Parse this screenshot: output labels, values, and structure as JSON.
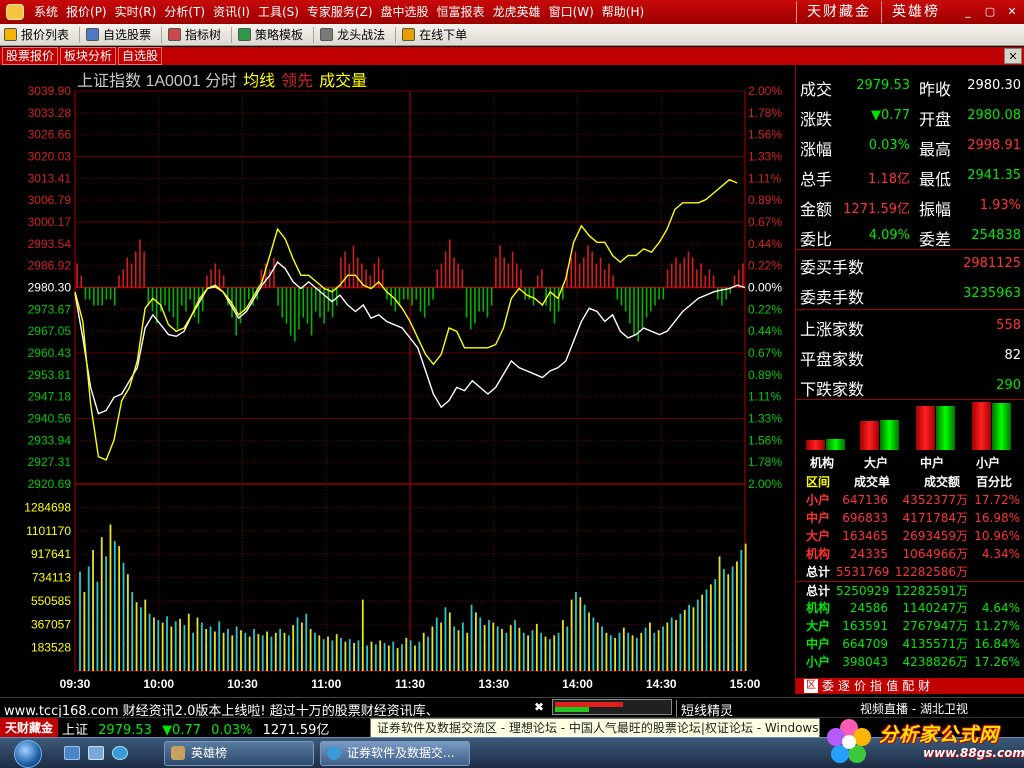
{
  "menubar": {
    "items": [
      "系统",
      "报价(P)",
      "实时(R)",
      "分析(T)",
      "资讯(I)",
      "工具(S)",
      "专家服务(Z)",
      "盘中选股",
      "恒富报表",
      "龙虎英雄",
      "窗口(W)",
      "帮助(H)"
    ],
    "brand": [
      "天财藏金",
      "英雄榜"
    ],
    "window_buttons": [
      "_",
      "▢",
      "✕"
    ]
  },
  "toolbar": {
    "items": [
      "报价列表",
      "自选股票",
      "指标树",
      "策略模板",
      "龙头战法",
      "在线下单"
    ]
  },
  "subtabs": {
    "items": [
      "股票报价",
      "板块分析",
      "自选股"
    ],
    "close": "✕"
  },
  "chart_data": {
    "type": "line",
    "title": "上证指数 1A0001 分时",
    "legend": [
      {
        "name": "均线",
        "color": "#ffff00"
      },
      {
        "name": "领先",
        "color": "#d22020"
      },
      {
        "name": "成交量",
        "color": "#ffff00"
      }
    ],
    "prev_close": 2980.3,
    "price_axis": [
      "3039.90",
      "3033.28",
      "3026.66",
      "3020.03",
      "3013.41",
      "3006.79",
      "3000.17",
      "2993.54",
      "2986.92",
      "2980.30",
      "2973.67",
      "2967.05",
      "2960.43",
      "2953.81",
      "2947.18",
      "2940.56",
      "2933.94",
      "2927.31",
      "2920.69"
    ],
    "pct_axis": [
      "2.00%",
      "1.78%",
      "1.56%",
      "1.33%",
      "1.11%",
      "0.89%",
      "0.67%",
      "0.44%",
      "0.22%",
      "0.00%",
      "0.22%",
      "0.44%",
      "0.67%",
      "0.89%",
      "1.11%",
      "1.33%",
      "1.56%",
      "1.78%",
      "2.00%"
    ],
    "volume_axis": [
      "1284698",
      "1101170",
      "917641",
      "734113",
      "550585",
      "367057",
      "183528"
    ],
    "time_axis": [
      "09:30",
      "10:00",
      "10:30",
      "11:00",
      "11:30",
      "13:30",
      "14:00",
      "14:30",
      "15:00"
    ],
    "ylim": [
      2920.69,
      3039.9
    ],
    "volume_max": 1468226,
    "series": [
      {
        "name": "分时",
        "color": "#ffffff",
        "points": [
          [
            0,
            2978.5
          ],
          [
            2,
            2965
          ],
          [
            4,
            2950
          ],
          [
            6,
            2942
          ],
          [
            8,
            2943
          ],
          [
            10,
            2947
          ],
          [
            12,
            2948
          ],
          [
            14,
            2952
          ],
          [
            16,
            2956
          ],
          [
            18,
            2968
          ],
          [
            20,
            2972
          ],
          [
            22,
            2969
          ],
          [
            24,
            2966
          ],
          [
            26,
            2965.5
          ],
          [
            28,
            2967
          ],
          [
            30,
            2972
          ],
          [
            32,
            2976
          ],
          [
            34,
            2980
          ],
          [
            36,
            2980.5
          ],
          [
            38,
            2979
          ],
          [
            40,
            2975
          ],
          [
            42,
            2971
          ],
          [
            44,
            2973
          ],
          [
            46,
            2977
          ],
          [
            48,
            2981
          ],
          [
            50,
            2984
          ],
          [
            52,
            2988
          ],
          [
            54,
            2986
          ],
          [
            56,
            2982
          ],
          [
            58,
            2980
          ],
          [
            60,
            2982
          ],
          [
            62,
            2980
          ],
          [
            64,
            2978
          ],
          [
            66,
            2976
          ],
          [
            68,
            2978
          ],
          [
            70,
            2975
          ],
          [
            72,
            2973
          ],
          [
            74,
            2975
          ],
          [
            76,
            2971
          ],
          [
            78,
            2972
          ],
          [
            80,
            2970
          ],
          [
            82,
            2969
          ],
          [
            84,
            2968
          ],
          [
            86,
            2965
          ],
          [
            88,
            2962
          ],
          [
            90,
            2955
          ],
          [
            92,
            2948
          ],
          [
            94,
            2944
          ],
          [
            96,
            2946
          ],
          [
            98,
            2950
          ],
          [
            100,
            2949
          ],
          [
            102,
            2952
          ],
          [
            104,
            2950
          ],
          [
            106,
            2948
          ],
          [
            108,
            2950
          ],
          [
            110,
            2954
          ],
          [
            112,
            2958
          ],
          [
            114,
            2956
          ],
          [
            116,
            2955
          ],
          [
            118,
            2954
          ],
          [
            120,
            2953
          ],
          [
            122,
            2955
          ],
          [
            124,
            2956
          ],
          [
            126,
            2958
          ],
          [
            128,
            2964
          ],
          [
            130,
            2970
          ],
          [
            132,
            2974
          ],
          [
            134,
            2973
          ],
          [
            136,
            2970
          ],
          [
            138,
            2972
          ],
          [
            140,
            2967
          ],
          [
            142,
            2965
          ],
          [
            144,
            2966
          ],
          [
            146,
            2968
          ],
          [
            148,
            2967
          ],
          [
            150,
            2966
          ],
          [
            152,
            2967
          ],
          [
            154,
            2970
          ],
          [
            156,
            2973
          ],
          [
            158,
            2975
          ],
          [
            160,
            2977
          ],
          [
            162,
            2978
          ],
          [
            164,
            2979
          ],
          [
            166,
            2979.5
          ],
          [
            168,
            2980
          ],
          [
            170,
            2981
          ],
          [
            172,
            2980.3
          ]
        ]
      },
      {
        "name": "均线",
        "color": "#ffff00",
        "points": [
          [
            0,
            2979
          ],
          [
            2,
            2970
          ],
          [
            4,
            2945
          ],
          [
            6,
            2929
          ],
          [
            8,
            2928
          ],
          [
            10,
            2934
          ],
          [
            12,
            2946
          ],
          [
            14,
            2950
          ],
          [
            16,
            2958
          ],
          [
            18,
            2974
          ],
          [
            20,
            2977
          ],
          [
            22,
            2975
          ],
          [
            24,
            2969
          ],
          [
            26,
            2967
          ],
          [
            28,
            2968
          ],
          [
            30,
            2972
          ],
          [
            32,
            2977
          ],
          [
            34,
            2980
          ],
          [
            36,
            2981
          ],
          [
            38,
            2979
          ],
          [
            40,
            2976
          ],
          [
            42,
            2972
          ],
          [
            44,
            2974
          ],
          [
            46,
            2978
          ],
          [
            48,
            2982
          ],
          [
            50,
            2990
          ],
          [
            52,
            2998
          ],
          [
            54,
            2995
          ],
          [
            56,
            2989
          ],
          [
            58,
            2984
          ],
          [
            60,
            2984
          ],
          [
            62,
            2982
          ],
          [
            64,
            2980
          ],
          [
            66,
            2979
          ],
          [
            68,
            2981
          ],
          [
            70,
            2984
          ],
          [
            72,
            2984
          ],
          [
            74,
            2981
          ],
          [
            76,
            2980
          ],
          [
            78,
            2982
          ],
          [
            80,
            2979
          ],
          [
            82,
            2977
          ],
          [
            84,
            2974
          ],
          [
            86,
            2970
          ],
          [
            88,
            2965
          ],
          [
            90,
            2960
          ],
          [
            92,
            2957
          ],
          [
            94,
            2960
          ],
          [
            96,
            2968
          ],
          [
            98,
            2967
          ],
          [
            100,
            2962
          ],
          [
            102,
            2962
          ],
          [
            104,
            2962
          ],
          [
            106,
            2962
          ],
          [
            108,
            2963
          ],
          [
            110,
            2968
          ],
          [
            112,
            2977
          ],
          [
            114,
            2980
          ],
          [
            116,
            2978
          ],
          [
            118,
            2977
          ],
          [
            120,
            2975
          ],
          [
            122,
            2979
          ],
          [
            124,
            2977
          ],
          [
            126,
            2983
          ],
          [
            128,
            2994
          ],
          [
            130,
            2999
          ],
          [
            132,
            2996
          ],
          [
            134,
            2994
          ],
          [
            136,
            2994
          ],
          [
            138,
            2990
          ],
          [
            140,
            2988
          ],
          [
            142,
            2990
          ],
          [
            144,
            2990
          ],
          [
            146,
            2992
          ],
          [
            148,
            2991
          ],
          [
            150,
            2994
          ],
          [
            152,
            2998
          ],
          [
            154,
            3004
          ],
          [
            156,
            3006
          ],
          [
            158,
            3006
          ],
          [
            160,
            3006
          ],
          [
            162,
            3007
          ],
          [
            164,
            3009
          ],
          [
            166,
            3011
          ],
          [
            168,
            3013
          ],
          [
            170,
            3012
          ]
        ]
      }
    ],
    "lead_bars": [
      4,
      2,
      -2,
      -2,
      -3,
      -3,
      -3,
      -2,
      -2,
      -3,
      2,
      3,
      5,
      4,
      6,
      8,
      6,
      -3,
      -4,
      -6,
      -4,
      -3,
      -4,
      -5,
      -7,
      -3,
      -4,
      -2,
      -5,
      -6,
      -4,
      2,
      3,
      4,
      3,
      2,
      -3,
      -5,
      -8,
      -6,
      -4,
      -2,
      -3,
      -2,
      3,
      4,
      3,
      5,
      -3,
      -5,
      -6,
      -8,
      -9,
      -7,
      -5,
      -6,
      -8,
      -4,
      -5,
      -6,
      -4,
      -5,
      -3,
      5,
      6,
      4,
      7,
      5,
      4,
      3,
      2,
      4,
      5,
      3,
      -2,
      -3,
      -4,
      -3,
      -2,
      -2,
      -3,
      -2,
      -4,
      -5,
      -3,
      -2,
      3,
      4,
      6,
      8,
      5,
      4,
      3,
      -5,
      -7,
      -6,
      -4,
      -4,
      -5,
      -3,
      5,
      7,
      5,
      4,
      6,
      4,
      3,
      -2,
      -2,
      -3,
      2,
      3,
      -3,
      -4,
      -6,
      -4,
      -2,
      3,
      5,
      6,
      4,
      5,
      7,
      6,
      4,
      5,
      3,
      4,
      2,
      -2,
      -3,
      -4,
      -6,
      -8,
      -9,
      -7,
      -5,
      -4,
      -3,
      -2,
      -2,
      3,
      4,
      5,
      4,
      5,
      6,
      5,
      3,
      4,
      2,
      3,
      2,
      -2,
      -3,
      -2,
      -1,
      2,
      3,
      4
    ],
    "volume": [
      780000,
      620000,
      820000,
      950000,
      700000,
      1050000,
      900000,
      1150000,
      1020000,
      980000,
      850000,
      760000,
      620000,
      540000,
      500000,
      560000,
      450000,
      420000,
      400000,
      380000,
      430000,
      350000,
      390000,
      410000,
      360000,
      450000,
      300000,
      420000,
      380000,
      330000,
      350000,
      310000,
      390000,
      300000,
      330000,
      280000,
      350000,
      320000,
      300000,
      270000,
      330000,
      290000,
      280000,
      310000,
      270000,
      300000,
      330000,
      300000,
      280000,
      360000,
      420000,
      380000,
      450000,
      330000,
      300000,
      280000,
      250000,
      270000,
      240000,
      290000,
      260000,
      230000,
      250000,
      220000,
      240000,
      560000,
      200000,
      230000,
      210000,
      240000,
      220000,
      200000,
      230000,
      180000,
      210000,
      260000,
      240000,
      200000,
      230000,
      300000,
      270000,
      350000,
      420000,
      380000,
      500000,
      460000,
      350000,
      320000,
      380000,
      300000,
      520000,
      460000,
      420000,
      360000,
      400000,
      380000,
      350000,
      330000,
      300000,
      360000,
      400000,
      340000,
      300000,
      280000,
      320000,
      370000,
      300000,
      270000,
      250000,
      280000,
      300000,
      400000,
      350000,
      560000,
      620000,
      580000,
      520000,
      460000,
      420000,
      380000,
      350000,
      300000,
      280000,
      260000,
      300000,
      340000,
      300000,
      280000,
      260000,
      300000,
      340000,
      380000,
      300000,
      320000,
      350000,
      380000,
      420000,
      400000,
      450000,
      480000,
      520000,
      500000,
      560000,
      600000,
      640000,
      680000,
      720000,
      900000,
      800000,
      760000,
      820000,
      860000,
      950000,
      1000000
    ]
  },
  "quote": {
    "rows": [
      {
        "l1": "成交",
        "v1": "2979.53",
        "c1": "#00e600",
        "l2": "昨收",
        "v2": "2980.30",
        "c2": "#ffffff"
      },
      {
        "l1": "涨跌",
        "v1": "▼0.77",
        "c1": "#00e600",
        "l2": "开盘",
        "v2": "2980.08",
        "c2": "#00e600"
      },
      {
        "l1": "涨幅",
        "v1": "0.03%",
        "c1": "#00e600",
        "l2": "最高",
        "v2": "2998.91",
        "c2": "#ff3232"
      },
      {
        "l1": "总手",
        "v1": "1.18亿",
        "c1": "#ff3232",
        "l2": "最低",
        "v2": "2941.35",
        "c2": "#00e600"
      },
      {
        "l1": "金额",
        "v1": "1271.59亿",
        "c1": "#ff3232",
        "l2": "振幅",
        "v2": "1.93%",
        "c2": "#ff3232"
      },
      {
        "l1": "委比",
        "v1": "4.09%",
        "c1": "#00e600",
        "l2": "委差",
        "v2": "254838",
        "c2": "#00e600"
      }
    ],
    "stats": [
      {
        "label": "委买手数",
        "value": "2981125",
        "color": "#ff3232"
      },
      {
        "label": "委卖手数",
        "value": "3235963",
        "color": "#00e600"
      },
      {
        "label": "上涨家数",
        "value": "558",
        "color": "#ff3232"
      },
      {
        "label": "平盘家数",
        "value": "82",
        "color": "#ffffff"
      },
      {
        "label": "下跌家数",
        "value": "290",
        "color": "#00e600"
      }
    ]
  },
  "fund_flow": {
    "labels": [
      "机构",
      "大户",
      "中户",
      "小户"
    ],
    "bars": [
      {
        "red": 0.2,
        "green": 0.22
      },
      {
        "red": 0.55,
        "green": 0.58
      },
      {
        "red": 0.85,
        "green": 0.85
      },
      {
        "red": 0.92,
        "green": 0.9
      }
    ],
    "header": [
      "区间",
      "成交单",
      "成交额",
      "百分比"
    ],
    "buy_rows": [
      {
        "name": "小户",
        "orders": "647136",
        "amount": "4352377万",
        "pct": "17.72%"
      },
      {
        "name": "中户",
        "orders": "696833",
        "amount": "4171784万",
        "pct": "16.98%"
      },
      {
        "name": "大户",
        "orders": "163465",
        "amount": "2693459万",
        "pct": "10.96%"
      },
      {
        "name": "机构",
        "orders": "24335",
        "amount": "1064966万",
        "pct": "4.34%"
      }
    ],
    "buy_total": {
      "name": "总计",
      "orders": "5531769",
      "amount": "12282586万",
      "pct": ""
    },
    "sell_total": {
      "name": "总计",
      "orders": "5250929",
      "amount": "12282591万",
      "pct": ""
    },
    "sell_rows": [
      {
        "name": "机构",
        "orders": "24586",
        "amount": "1140247万",
        "pct": "4.64%"
      },
      {
        "name": "大户",
        "orders": "163591",
        "amount": "2767947万",
        "pct": "11.27%"
      },
      {
        "name": "中户",
        "orders": "664709",
        "amount": "4135571万",
        "pct": "16.84%"
      },
      {
        "name": "小户",
        "orders": "398043",
        "amount": "4238826万",
        "pct": "17.26%"
      }
    ],
    "tabs": [
      "委",
      "逐",
      "价",
      "指",
      "值",
      "配",
      "财"
    ],
    "tab_icon": "区"
  },
  "ticker": {
    "message": "www.tccj168.com  财经资讯2.0版本上线啦! 超过十万的股票财经资讯库、",
    "meter_red": 0.6,
    "meter_green": 0.3,
    "short": "短线精灵",
    "video": "视频直播 - 湖北卫视"
  },
  "statusbar": {
    "brand": "天财藏金",
    "index_name": "上证",
    "index_price": "2979.53",
    "index_change": "▼0.77",
    "index_pct": "0.03%",
    "index_amount": "1271.59亿",
    "hint": "证券软件及数据交流区 - 理想论坛 - 中国人气最旺的股票论坛|权证论坛 - Windows"
  },
  "taskbar": {
    "tasks": [
      "英雄榜",
      "证券软件及数据交..."
    ]
  },
  "watermark": {
    "title": "分析家公式网",
    "url": "www.88gs.com"
  }
}
